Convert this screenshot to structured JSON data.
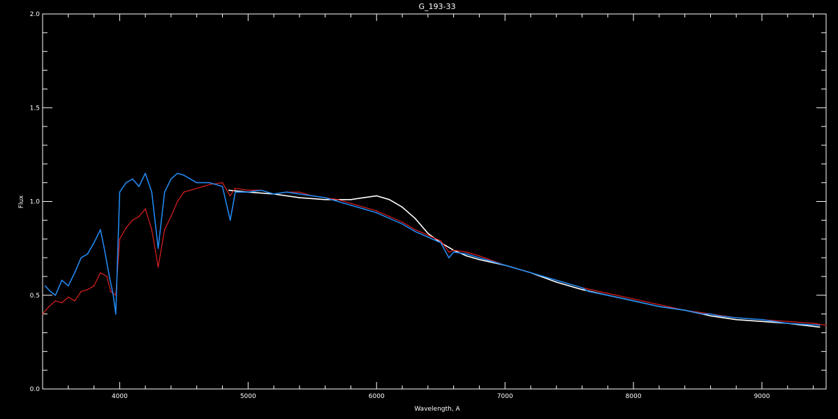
{
  "chart_data": {
    "type": "line",
    "title": "G_193-33",
    "xlabel": "Wavelength, A",
    "ylabel": "Flux",
    "xlim": [
      3400,
      9500
    ],
    "ylim": [
      0.0,
      2.0
    ],
    "xticks": [
      {
        "value": 4000,
        "label": "4000"
      },
      {
        "value": 5000,
        "label": "5000"
      },
      {
        "value": 6000,
        "label": "6000"
      },
      {
        "value": 7000,
        "label": "7000"
      },
      {
        "value": 8000,
        "label": "8000"
      },
      {
        "value": 9000,
        "label": "9000"
      }
    ],
    "yticks": [
      {
        "value": 0.0,
        "label": "0.0"
      },
      {
        "value": 0.5,
        "label": "0.5"
      },
      {
        "value": 1.0,
        "label": "1.0"
      },
      {
        "value": 1.5,
        "label": "1.5"
      },
      {
        "value": 2.0,
        "label": "2.0"
      }
    ],
    "grid": false,
    "background": "#000000",
    "axis_color": "#ffffff",
    "series": [
      {
        "key": "observed_white",
        "color": "#ffffff",
        "x": [
          4850,
          5000,
          5200,
          5400,
          5600,
          5700,
          5800,
          5900,
          6000,
          6100,
          6200,
          6300,
          6400,
          6500,
          6600,
          6700,
          6800,
          7000,
          7200,
          7400,
          7600,
          7800,
          8000,
          8200,
          8400,
          8600,
          8800,
          9000,
          9200,
          9450
        ],
        "y": [
          1.06,
          1.05,
          1.04,
          1.02,
          1.01,
          1.01,
          1.01,
          1.02,
          1.03,
          1.01,
          0.97,
          0.91,
          0.83,
          0.78,
          0.74,
          0.71,
          0.69,
          0.66,
          0.62,
          0.57,
          0.53,
          0.5,
          0.47,
          0.44,
          0.42,
          0.39,
          0.37,
          0.36,
          0.35,
          0.33
        ]
      },
      {
        "key": "model_red",
        "color": "#e02020",
        "x": [
          3400,
          3450,
          3500,
          3550,
          3600,
          3650,
          3700,
          3750,
          3800,
          3850,
          3900,
          3930,
          3970,
          4000,
          4050,
          4100,
          4150,
          4200,
          4250,
          4300,
          4350,
          4400,
          4450,
          4500,
          4550,
          4600,
          4650,
          4700,
          4800,
          4860,
          4900,
          5000,
          5100,
          5200,
          5300,
          5400,
          5500,
          5600,
          5700,
          5800,
          5900,
          6000,
          6100,
          6200,
          6300,
          6400,
          6500,
          6563,
          6600,
          6700,
          6800,
          7000,
          7200,
          7400,
          7600,
          7800,
          8000,
          8200,
          8400,
          8600,
          8800,
          9000,
          9200,
          9400,
          9500
        ],
        "y": [
          0.4,
          0.44,
          0.47,
          0.46,
          0.49,
          0.47,
          0.52,
          0.53,
          0.55,
          0.62,
          0.6,
          0.52,
          0.5,
          0.8,
          0.86,
          0.9,
          0.92,
          0.96,
          0.85,
          0.65,
          0.85,
          0.92,
          1.0,
          1.05,
          1.06,
          1.07,
          1.08,
          1.09,
          1.1,
          1.03,
          1.07,
          1.06,
          1.06,
          1.04,
          1.05,
          1.05,
          1.03,
          1.02,
          1.01,
          0.99,
          0.97,
          0.95,
          0.92,
          0.89,
          0.85,
          0.82,
          0.79,
          0.73,
          0.74,
          0.73,
          0.71,
          0.66,
          0.62,
          0.58,
          0.54,
          0.51,
          0.48,
          0.45,
          0.42,
          0.4,
          0.38,
          0.37,
          0.36,
          0.35,
          0.34
        ]
      },
      {
        "key": "observed_blue",
        "color": "#2288ee",
        "x": [
          3420,
          3460,
          3500,
          3550,
          3600,
          3650,
          3700,
          3750,
          3800,
          3850,
          3880,
          3920,
          3950,
          3970,
          4000,
          4050,
          4100,
          4150,
          4200,
          4250,
          4300,
          4350,
          4400,
          4450,
          4500,
          4550,
          4600,
          4700,
          4800,
          4861,
          4900,
          5000,
          5100,
          5200,
          5300,
          5400,
          5500,
          5600,
          5700,
          5800,
          5900,
          6000,
          6100,
          6200,
          6300,
          6400,
          6500,
          6563,
          6600,
          6700,
          6800,
          7000,
          7200,
          7400,
          7600,
          7650,
          7800,
          8000,
          8200,
          8400,
          8542,
          8600,
          8662,
          8800,
          9000,
          9200,
          9450
        ],
        "y": [
          0.55,
          0.52,
          0.5,
          0.58,
          0.55,
          0.62,
          0.7,
          0.72,
          0.78,
          0.85,
          0.75,
          0.6,
          0.5,
          0.4,
          1.05,
          1.1,
          1.12,
          1.08,
          1.15,
          1.05,
          0.75,
          1.05,
          1.12,
          1.15,
          1.14,
          1.12,
          1.1,
          1.1,
          1.08,
          0.9,
          1.05,
          1.05,
          1.06,
          1.04,
          1.05,
          1.04,
          1.03,
          1.02,
          1.0,
          0.98,
          0.96,
          0.94,
          0.91,
          0.88,
          0.84,
          0.81,
          0.78,
          0.7,
          0.73,
          0.72,
          0.7,
          0.66,
          0.62,
          0.58,
          0.54,
          0.52,
          0.5,
          0.47,
          0.44,
          0.42,
          0.4,
          0.4,
          0.39,
          0.38,
          0.37,
          0.35,
          0.34
        ]
      }
    ]
  }
}
